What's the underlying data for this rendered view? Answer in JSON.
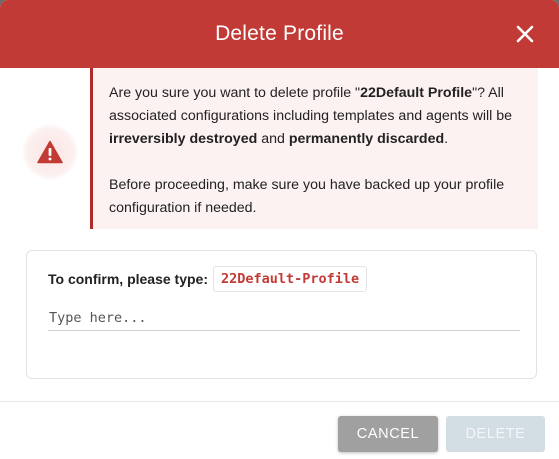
{
  "dialog": {
    "title": "Delete Profile",
    "close_icon": "close-icon"
  },
  "warning": {
    "icon": "warning-triangle-icon",
    "p1_a": "Are you sure you want to delete profile \"",
    "p1_profile": "22Default Profile",
    "p1_b": "\"? All associated configurations including templates and agents will be ",
    "p1_strong1": "irreversibly destroyed",
    "p1_c": " and ",
    "p1_strong2": "permanently discarded",
    "p1_d": ".",
    "p2": "Before proceeding, make sure you have backed up your profile configuration if needed."
  },
  "confirm": {
    "label": "To confirm, please type:",
    "code": "22Default-Profile",
    "input_value": "",
    "input_placeholder": "Type here..."
  },
  "footer": {
    "cancel_label": "CANCEL",
    "delete_label": "DELETE"
  },
  "colors": {
    "header": "#c23a35",
    "accent": "#b32a2a",
    "cancel_bg": "#a0a0a0",
    "delete_disabled_bg": "#d3dde4"
  }
}
